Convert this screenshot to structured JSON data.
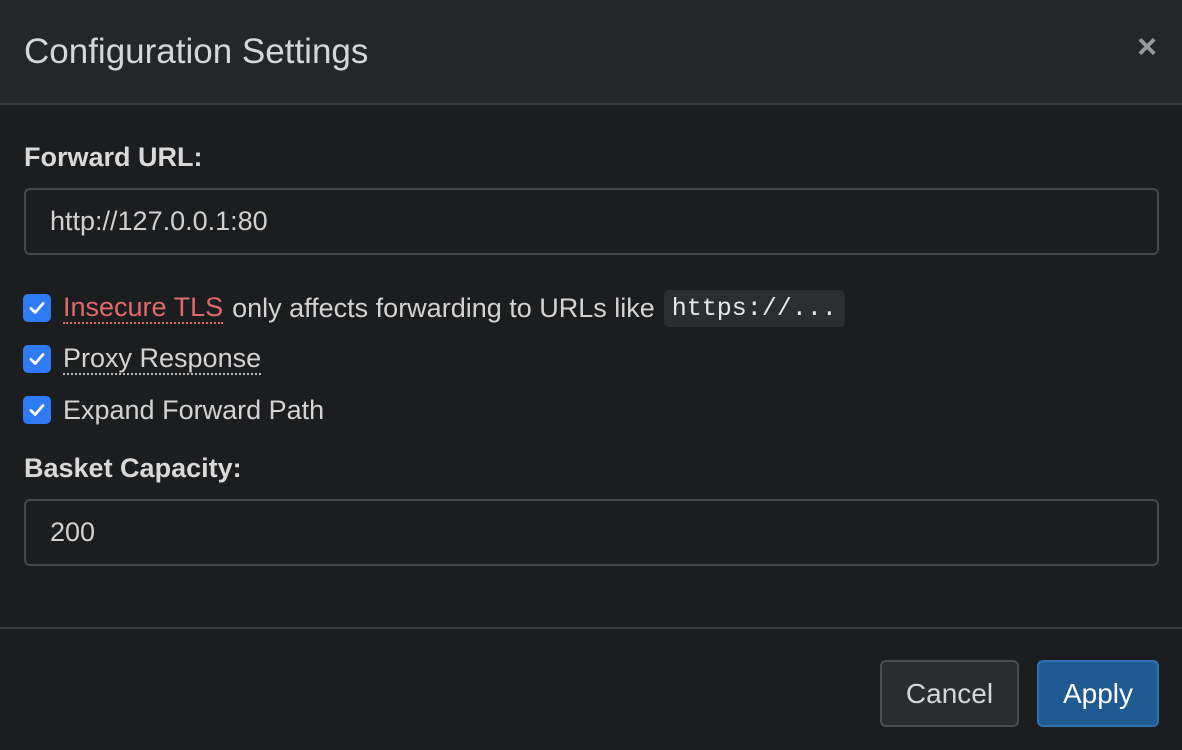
{
  "dialog": {
    "title": "Configuration Settings",
    "close_glyph": "×"
  },
  "forward_url": {
    "label": "Forward URL:",
    "value": "http://127.0.0.1:80"
  },
  "options": {
    "insecure_tls": {
      "label": "Insecure TLS",
      "checked": true,
      "hint": "only affects forwarding to URLs like",
      "code": "https://..."
    },
    "proxy_response": {
      "label": "Proxy Response",
      "checked": true
    },
    "expand_forward_path": {
      "label": "Expand Forward Path",
      "checked": true
    }
  },
  "basket_capacity": {
    "label": "Basket Capacity:",
    "value": "200"
  },
  "footer": {
    "cancel_label": "Cancel",
    "apply_label": "Apply"
  },
  "colors": {
    "accent": "#2f7bf4",
    "danger": "#e06a6a",
    "primary_button": "#1f5a92",
    "background": "#1c1d1f"
  }
}
